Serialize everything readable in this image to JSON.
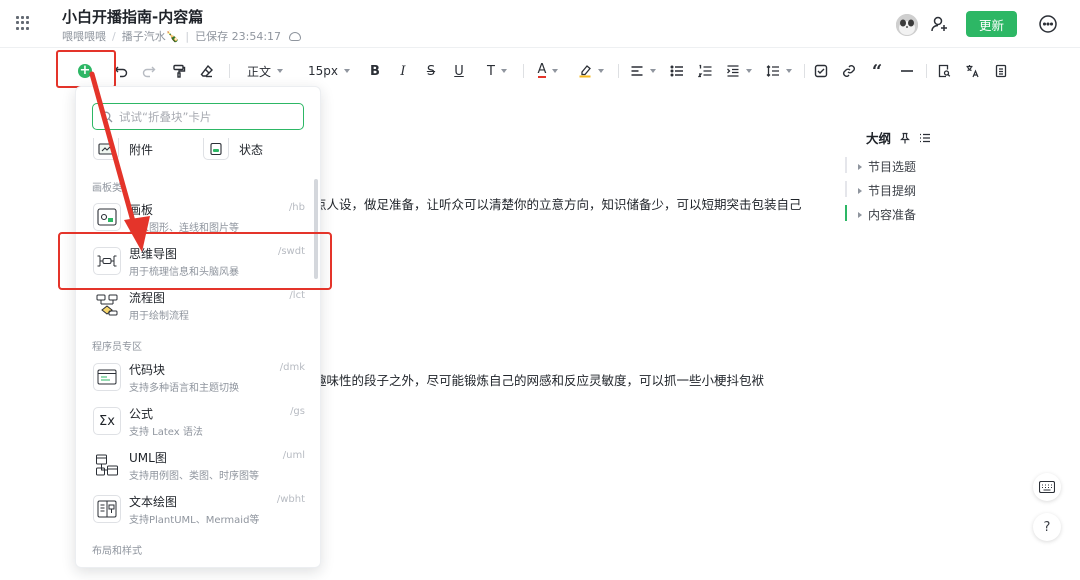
{
  "header": {
    "title": "小白开播指南-内容篇",
    "breadcrumb": [
      "喂喂喂喂",
      "播子汽水🍾",
      "已保存 23:54:17"
    ],
    "update_label": "更新"
  },
  "toolbar": {
    "paragraph_style": "正文",
    "font_size": "15px"
  },
  "content": {
    "line1": "点人设，做足准备，让听众可以清楚你的立意方向，知识储备少，可以短期突击包装自己",
    "line2": "趣味性的段子之外，尽可能锻炼自己的网感和反应灵敏度，可以抓一些小梗抖包袱"
  },
  "outline": {
    "title": "大纲",
    "items": [
      {
        "label": "节目选题",
        "active": false
      },
      {
        "label": "节目提纲",
        "active": false
      },
      {
        "label": "内容准备",
        "active": true
      }
    ]
  },
  "panel": {
    "search_placeholder": "试试“折叠块”卡片",
    "top_items": [
      "附件",
      "状态"
    ],
    "sections": [
      {
        "label": "画板类",
        "items": [
          {
            "name": "画板",
            "desc": "插入图形、连线和图片等",
            "shortcut": "/hb"
          },
          {
            "name": "思维导图",
            "desc": "用于梳理信息和头脑风暴",
            "shortcut": "/swdt"
          },
          {
            "name": "流程图",
            "desc": "用于绘制流程",
            "shortcut": "/lct"
          }
        ]
      },
      {
        "label": "程序员专区",
        "items": [
          {
            "name": "代码块",
            "desc": "支持多种语言和主题切换",
            "shortcut": "/dmk"
          },
          {
            "name": "公式",
            "desc": "支持 Latex 语法",
            "shortcut": "/gs"
          },
          {
            "name": "UML图",
            "desc": "支持用例图、类图、时序图等",
            "shortcut": "/uml"
          },
          {
            "name": "文本绘图",
            "desc": "支持PlantUML、Mermaid等",
            "shortcut": "/wbht"
          }
        ]
      },
      {
        "label": "布局和样式",
        "items": []
      }
    ]
  },
  "icons": {
    "accent": "#2db765",
    "annotation": "#e4342a"
  }
}
